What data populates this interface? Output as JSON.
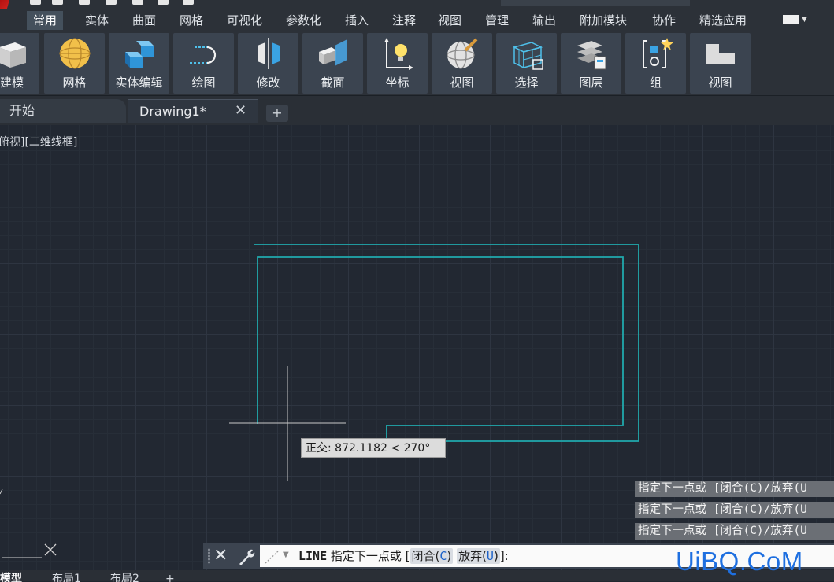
{
  "menu": {
    "tabs": [
      "常用",
      "实体",
      "曲面",
      "网格",
      "可视化",
      "参数化",
      "插入",
      "注释",
      "视图",
      "管理",
      "输出",
      "附加模块",
      "协作",
      "精选应用"
    ],
    "active_index": 0
  },
  "ribbon": {
    "panels": [
      {
        "label": "建模",
        "icon": "box-icon"
      },
      {
        "label": "网格",
        "icon": "mesh-sphere-icon"
      },
      {
        "label": "实体编辑",
        "icon": "solid-edit-icon"
      },
      {
        "label": "绘图",
        "icon": "draw-icon"
      },
      {
        "label": "修改",
        "icon": "modify-icon"
      },
      {
        "label": "截面",
        "icon": "section-icon"
      },
      {
        "label": "坐标",
        "icon": "ucs-icon"
      },
      {
        "label": "视图",
        "icon": "view-sphere-icon"
      },
      {
        "label": "选择",
        "icon": "select-icon"
      },
      {
        "label": "图层",
        "icon": "layers-icon"
      },
      {
        "label": "组",
        "icon": "group-icon"
      },
      {
        "label": "视图",
        "icon": "view-icon"
      }
    ]
  },
  "doc_tabs": {
    "start_label": "开始",
    "drawing_label": "Drawing1*",
    "close_glyph": "✕",
    "add_glyph": "+"
  },
  "viewport": {
    "label": "俯视][二维线框]"
  },
  "tooltip": {
    "text": "正交: 872.1182 < 270°"
  },
  "command_history": [
    "指定下一点或 [闭合(C)/放弃(U",
    "指定下一点或 [闭合(C)/放弃(U",
    "指定下一点或 [闭合(C)/放弃(U"
  ],
  "command_line": {
    "command": "LINE",
    "prompt": "指定下一点或 [",
    "option1": "闭合(",
    "option1_key": "C",
    "option1_close": ")",
    "option2": "放弃(",
    "option2_key": "U",
    "option2_close": ")",
    "suffix": "]:"
  },
  "layout_tabs": [
    "模型",
    "布局1",
    "布局2"
  ],
  "layout_add": "+",
  "watermark": "UiBQ.CoM",
  "colors": {
    "polyline": "#21a9ad",
    "crosshair": "#c8c8c8",
    "ribbon_button": "#3b4450",
    "canvas": "#222832"
  }
}
